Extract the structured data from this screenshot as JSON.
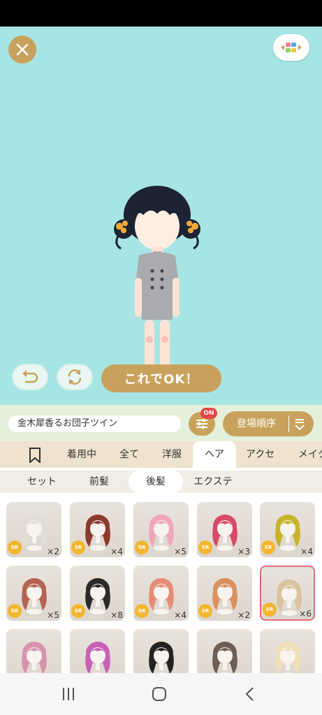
{
  "actions": {
    "ok_label": "これでOK！"
  },
  "info": {
    "item_name": "金木犀香るお団子ツイン",
    "filter_badge": "ON",
    "sort_label": "登場順序"
  },
  "category_tabs": [
    "着用中",
    "全て",
    "洋服",
    "ヘア",
    "アクセ",
    "メイク"
  ],
  "active_category": "ヘア",
  "sub_tabs": [
    "セット",
    "前髪",
    "後髪",
    "エクステ"
  ],
  "active_sub_tab": "後髪",
  "items": [
    {
      "rarity": "SR",
      "count": "×2",
      "hair_color": "#e0dcd7"
    },
    {
      "rarity": "SR",
      "count": "×4",
      "hair_color": "#8b3a2e"
    },
    {
      "rarity": "SR",
      "count": "×5",
      "hair_color": "#f0a7b5"
    },
    {
      "rarity": "SR",
      "count": "×3",
      "hair_color": "#d84a6a"
    },
    {
      "rarity": "SR",
      "count": "×4",
      "hair_color": "#c8b32a"
    },
    {
      "rarity": "SR",
      "count": "×5",
      "hair_color": "#b36452"
    },
    {
      "rarity": "SR",
      "count": "×8",
      "hair_color": "#2a2a2a"
    },
    {
      "rarity": "SR",
      "count": "×4",
      "hair_color": "#e58d78"
    },
    {
      "rarity": "SR",
      "count": "×2",
      "hair_color": "#d9915e"
    },
    {
      "rarity": "SR",
      "count": "×6",
      "hair_color": "#d9c2a0"
    },
    {
      "rarity": "",
      "count": "",
      "hair_color": "#d793ad"
    },
    {
      "rarity": "",
      "count": "",
      "hair_color": "#c760b7"
    },
    {
      "rarity": "",
      "count": "",
      "hair_color": "#222222"
    },
    {
      "rarity": "",
      "count": "",
      "hair_color": "#6e5d52"
    },
    {
      "rarity": "",
      "count": "",
      "hair_color": "#f0dfb8"
    }
  ],
  "selected_item": 9,
  "colors": {
    "accent": "#c8a25c",
    "stage_bg": "#a6e5e3",
    "badge_red": "#e64545",
    "sr_badge": "#f2b630",
    "selected_border": "#e46a78"
  }
}
